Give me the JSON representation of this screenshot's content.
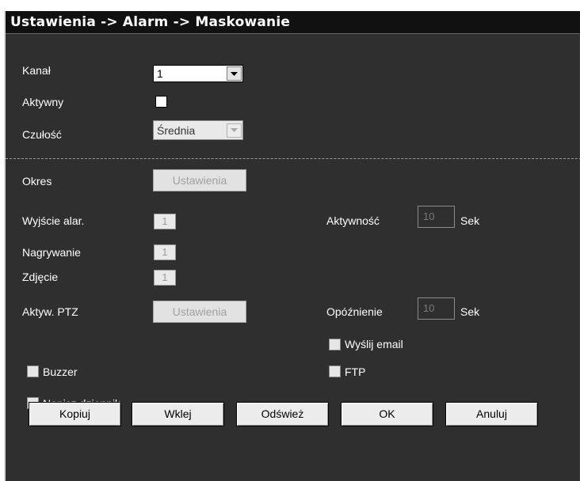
{
  "window": {
    "title": "Ustawienia -> Alarm -> Maskowanie"
  },
  "fields": {
    "kanal": {
      "label": "Kanał",
      "value": "1"
    },
    "aktywny": {
      "label": "Aktywny",
      "checked": false
    },
    "czulosc": {
      "label": "Czułość",
      "value": "Średnia"
    },
    "okres": {
      "label": "Okres",
      "button": "Ustawienia"
    },
    "wyjscie": {
      "label": "Wyjście alar.",
      "value": "1"
    },
    "nagrywanie": {
      "label": "Nagrywanie",
      "value": "1"
    },
    "zdjecie": {
      "label": "Zdjęcie",
      "value": "1"
    },
    "ptz": {
      "label": "Aktyw. PTZ",
      "button": "Ustawienia"
    },
    "aktywnosc": {
      "label": "Aktywność",
      "value": "10",
      "unit": "Sek"
    },
    "opoznienie": {
      "label": "Opóźnienie",
      "value": "10",
      "unit": "Sek"
    },
    "email": {
      "label": "Wyślij email",
      "checked": false
    },
    "buzzer": {
      "label": "Buzzer",
      "checked": false
    },
    "ftp": {
      "label": "FTP",
      "checked": false
    },
    "dziennik": {
      "label": "Napisz dziennik",
      "checked": false
    }
  },
  "buttons": {
    "kopiuj": "Kopiuj",
    "wklej": "Wklej",
    "odswiez": "Odśwież",
    "ok": "OK",
    "anuluj": "Anuluj"
  },
  "colors": {
    "panel_bg": "#2f2f2f",
    "titlebar_bg": "#111111",
    "text": "#ffffff"
  }
}
